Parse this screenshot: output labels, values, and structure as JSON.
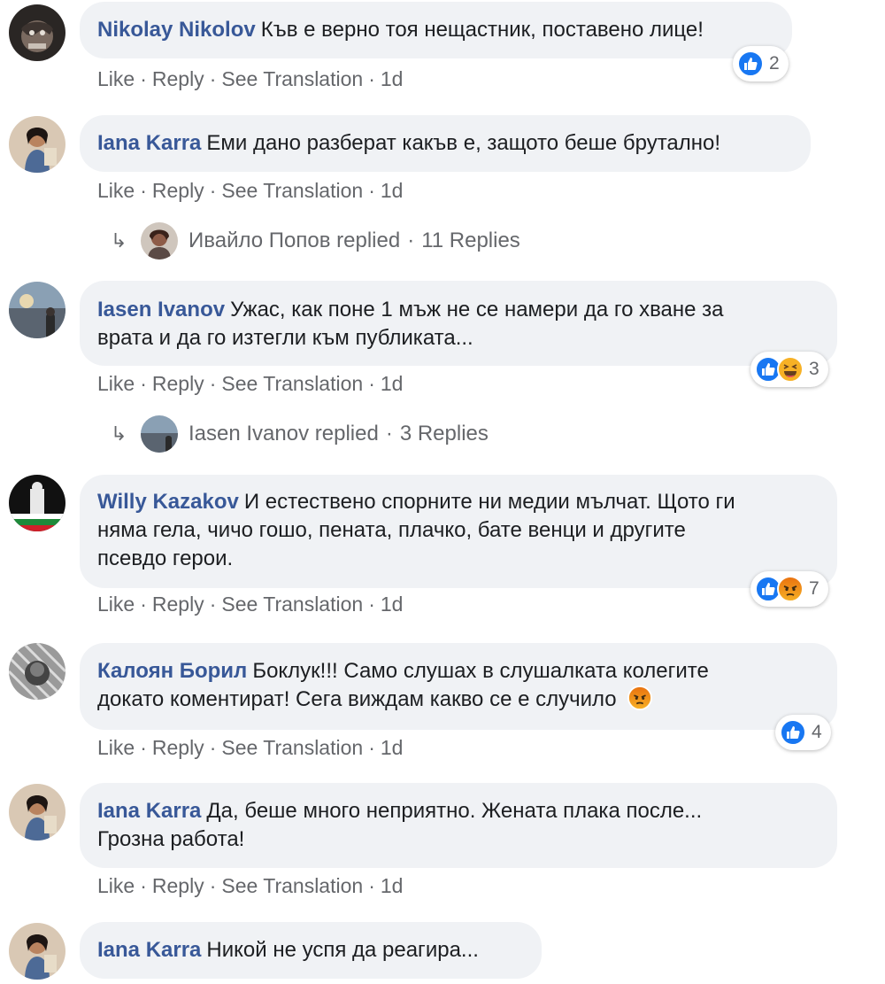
{
  "comments": [
    {
      "author": "Nikolay Nikolov",
      "text": "Къв е верно тоя нещастник, поставено лице!",
      "reaction_count": "2",
      "reactions": [
        "like-icon"
      ],
      "actions": {
        "like": "Like",
        "reply": "Reply",
        "translate": "See Translation",
        "time": "1d"
      }
    },
    {
      "author": "Iana Karra",
      "text": "Еми дано разберат какъв е, защото беше брутално!",
      "actions": {
        "like": "Like",
        "reply": "Reply",
        "translate": "See Translation",
        "time": "1d"
      },
      "replies": {
        "who": "Ивайло Попов replied",
        "count": "11 Replies"
      }
    },
    {
      "author": "Iasen Ivanov",
      "text_line1": "Ужас, как поне 1 мъж не се намери да го хване за",
      "text_line2": "врата и да го изтегли към публиката...",
      "reaction_count": "3",
      "reactions": [
        "like-icon",
        "laugh-icon"
      ],
      "actions": {
        "like": "Like",
        "reply": "Reply",
        "translate": "See Translation",
        "time": "1d"
      },
      "replies": {
        "who": "Iasen Ivanov replied",
        "count": "3 Replies"
      }
    },
    {
      "author": "Willy Kazakov",
      "text_line1": "И естествено спорните ни медии мълчат. Щото ги",
      "text_line2": "няма гела, чичо гошо, пената, плачко, бате венци и другите",
      "text_line3": "псевдо герои.",
      "reaction_count": "7",
      "reactions": [
        "like-icon",
        "angry-icon"
      ],
      "actions": {
        "like": "Like",
        "reply": "Reply",
        "translate": "See Translation",
        "time": "1d"
      }
    },
    {
      "author": "Калоян Борил",
      "text_line1": "Боклук!!! Само слушах в слушалката колегите",
      "text_line2": "докато коментират! Сега виждам какво се е случило",
      "reaction_count": "4",
      "reactions": [
        "like-icon"
      ],
      "actions": {
        "like": "Like",
        "reply": "Reply",
        "translate": "See Translation",
        "time": "1d"
      }
    },
    {
      "author": "Iana Karra",
      "text_line1": "Да, беше много неприятно. Жената плака после...",
      "text_line2": "Грозна работа!",
      "actions": {
        "like": "Like",
        "reply": "Reply",
        "translate": "See Translation",
        "time": "1d"
      }
    },
    {
      "author": "Iana Karra",
      "text": "Никой не успя да реагира..."
    }
  ],
  "colors": {
    "author": "#385898",
    "bubble_bg": "#f0f2f5",
    "meta_text": "#65676b",
    "like_blue": "#1877f2",
    "haha_yellow": "#f7b125",
    "angry_orange": "#e9710f"
  },
  "separator": "·",
  "reply_arrow": "↳"
}
